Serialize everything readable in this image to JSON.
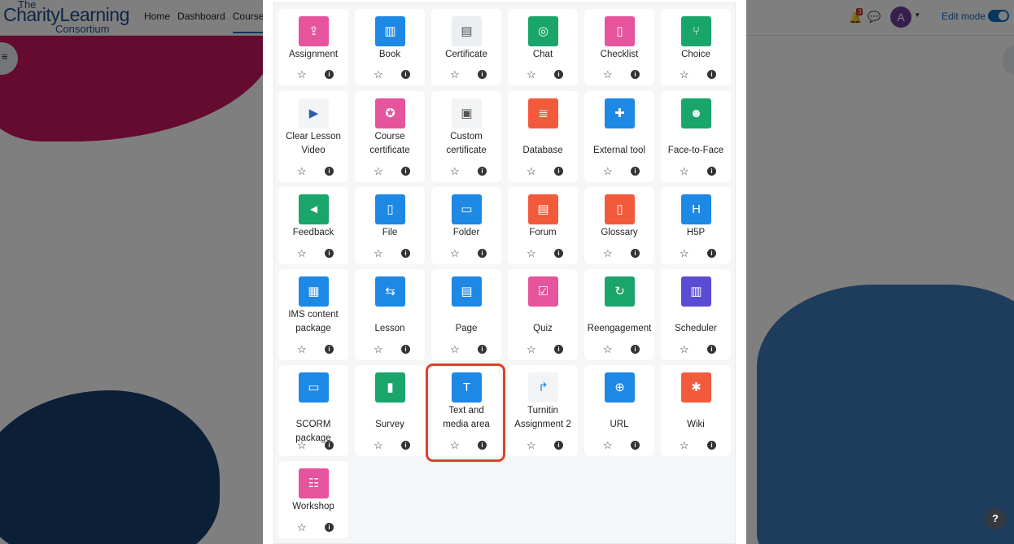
{
  "header": {
    "logo": {
      "line1": "The",
      "line2": "CharityLearning",
      "line3": "Consortium"
    },
    "nav": [
      "Home",
      "Dashboard",
      "Courses"
    ],
    "notification_count": "3",
    "avatar_initial": "A",
    "edit_mode_label": "Edit mode"
  },
  "help_label": "?",
  "activity_chooser": {
    "rows": [
      [
        {
          "label": "Assignment",
          "icon": "assignment-icon",
          "color": "#e5549c"
        },
        {
          "label": "Book",
          "icon": "book-icon",
          "color": "#1e88e5"
        },
        {
          "label": "Certificate",
          "icon": "certificate-icon",
          "color": "#eceff1"
        },
        {
          "label": "Chat",
          "icon": "chat-icon",
          "color": "#1aa56b"
        },
        {
          "label": "Checklist",
          "icon": "checklist-icon",
          "color": "#e5549c"
        },
        {
          "label": "Choice",
          "icon": "choice-icon",
          "color": "#1aa56b"
        }
      ],
      [
        {
          "label": "Clear Lesson Video",
          "icon": "video-play-icon",
          "color": "#f2f4f6"
        },
        {
          "label": "Course certificate",
          "icon": "course-certificate-icon",
          "color": "#e5549c"
        },
        {
          "label": "Custom certificate",
          "icon": "custom-certificate-icon",
          "color": "#f2f4f6"
        },
        {
          "label": "Database",
          "icon": "database-icon",
          "color": "#f25a3c"
        },
        {
          "label": "External tool",
          "icon": "puzzle-icon",
          "color": "#1e88e5"
        },
        {
          "label": "Face-to-Face",
          "icon": "face-to-face-icon",
          "color": "#1aa56b"
        }
      ],
      [
        {
          "label": "Feedback",
          "icon": "megaphone-icon",
          "color": "#1aa56b"
        },
        {
          "label": "File",
          "icon": "file-icon",
          "color": "#1e88e5"
        },
        {
          "label": "Folder",
          "icon": "folder-icon",
          "color": "#1e88e5"
        },
        {
          "label": "Forum",
          "icon": "forum-icon",
          "color": "#f25a3c"
        },
        {
          "label": "Glossary",
          "icon": "glossary-icon",
          "color": "#f25a3c"
        },
        {
          "label": "H5P",
          "icon": "h5p-icon",
          "color": "#1e88e5"
        }
      ],
      [
        {
          "label": "IMS content package",
          "icon": "ims-package-icon",
          "color": "#1e88e5"
        },
        {
          "label": "Lesson",
          "icon": "lesson-icon",
          "color": "#1e88e5"
        },
        {
          "label": "Page",
          "icon": "page-icon",
          "color": "#1e88e5"
        },
        {
          "label": "Quiz",
          "icon": "quiz-icon",
          "color": "#e5549c"
        },
        {
          "label": "Reengagement",
          "icon": "reengagement-icon",
          "color": "#1aa56b"
        },
        {
          "label": "Scheduler",
          "icon": "scheduler-icon",
          "color": "#5b4cd3"
        }
      ],
      [
        {
          "label": "SCORM package",
          "icon": "scorm-icon",
          "color": "#1e88e5"
        },
        {
          "label": "Survey",
          "icon": "survey-chart-icon",
          "color": "#1aa56b"
        },
        {
          "label": "Text and media area",
          "icon": "text-media-icon",
          "color": "#1e88e5"
        },
        {
          "label": "Turnitin Assignment 2",
          "icon": "turnitin-icon",
          "color": "#f2f4f6"
        },
        {
          "label": "URL",
          "icon": "globe-icon",
          "color": "#1e88e5"
        },
        {
          "label": "Wiki",
          "icon": "wiki-icon",
          "color": "#f25a3c"
        }
      ],
      [
        {
          "label": "Workshop",
          "icon": "workshop-icon",
          "color": "#e5549c"
        }
      ]
    ],
    "highlighted": "Text and media area"
  }
}
